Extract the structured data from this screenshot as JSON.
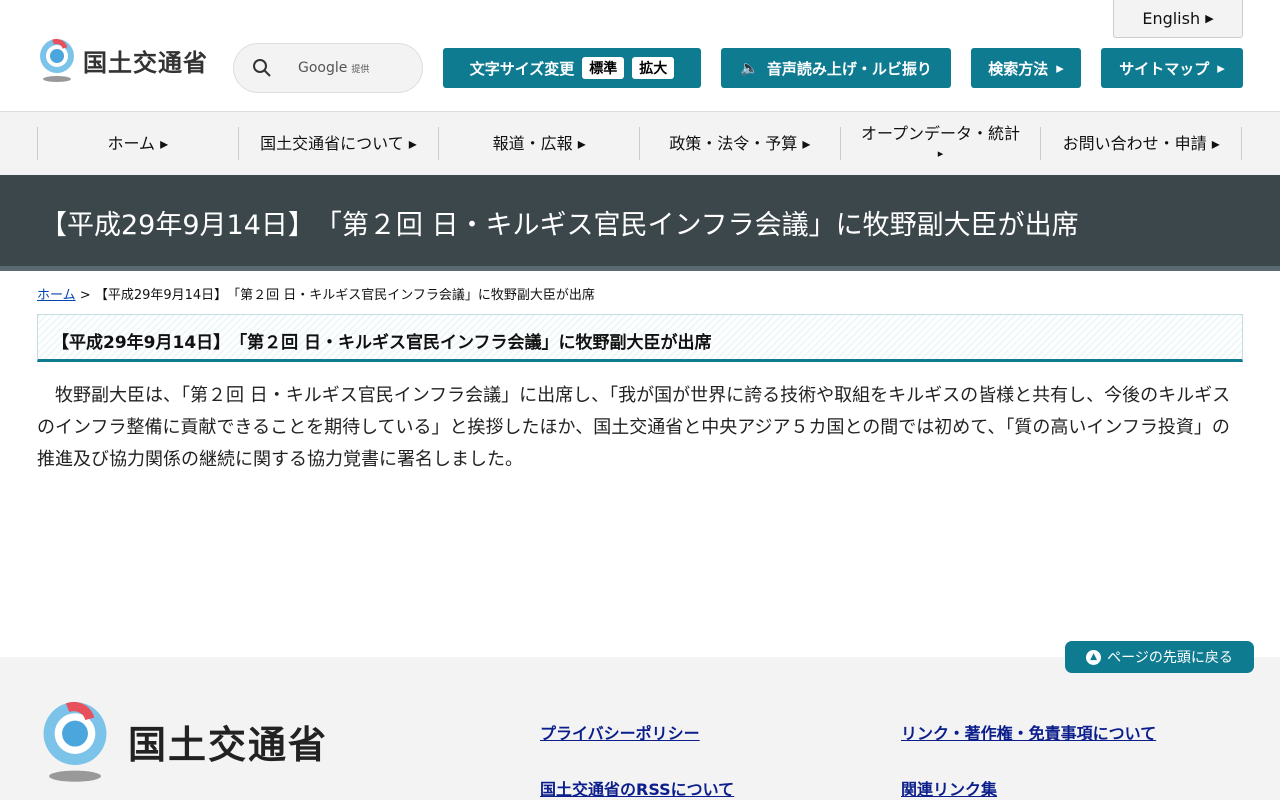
{
  "header": {
    "logo_text": "国土交通省",
    "search": {
      "provider": "Google",
      "provider_suffix": "提供"
    },
    "font_size": {
      "label": "文字サイズ変更",
      "standard": "標準",
      "large": "拡大"
    },
    "speech": "音声読み上げ・ルビ振り",
    "search_method": "検索方法",
    "sitemap": "サイトマップ",
    "english": "English"
  },
  "nav": {
    "items": [
      {
        "label": "ホーム"
      },
      {
        "label": "国土交通省について"
      },
      {
        "label": "報道・広報"
      },
      {
        "label": "政策・法令・予算"
      },
      {
        "label": "オープンデータ・統計"
      },
      {
        "label": "お問い合わせ・申請"
      }
    ]
  },
  "page": {
    "title": "【平成29年9月14日】　「第２回 日・キルギス官民インフラ会議」に牧野副大臣が出席",
    "breadcrumb": {
      "home": "ホーム",
      "sep": ">",
      "current": "【平成29年9月14日】　「第２回 日・キルギス官民インフラ会議」に牧野副大臣が出席"
    },
    "heading": "【平成29年9月14日】　「第２回 日・キルギス官民インフラ会議」に牧野副大臣が出席",
    "body": "　牧野副大臣は、「第２回 日・キルギス官民インフラ会議」に出席し、「我が国が世界に誇る技術や取組をキルギスの皆様と共有し、今後のキルギスのインフラ整備に貢献できることを期待している」と挨拶したほか、国土交通省と中央アジア５カ国との間では初めて、「質の高いインフラ投資」の推進及び協力関係の継続に関する協力覚書に署名しました。"
  },
  "footer": {
    "back_to_top": "ページの先頭に戻る",
    "logo_text": "国土交通省",
    "links": [
      "プライバシーポリシー",
      "リンク・著作権・免責事項について",
      "国土交通省のRSSについて",
      "関連リンク集"
    ]
  },
  "colors": {
    "accent": "#0f7b91",
    "banner": "#3c474c",
    "link": "#0b1e8c"
  }
}
